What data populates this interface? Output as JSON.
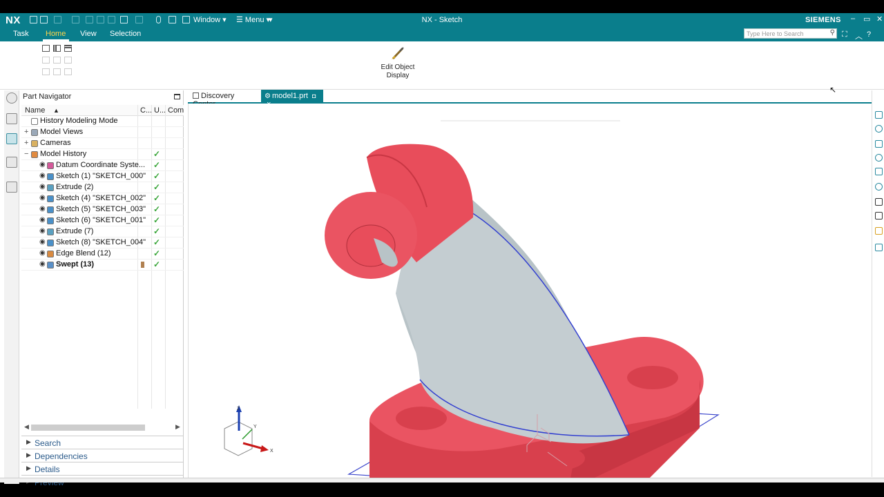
{
  "app": {
    "logo": "NX",
    "window_title": "NX - Sketch",
    "brand": "SIEMENS",
    "quick_access": {
      "window_label": "Window ▾",
      "menu_label": "☰ Menu ▾"
    }
  },
  "ribbon": {
    "tabs": [
      {
        "label": "Task",
        "active": false
      },
      {
        "label": "Home",
        "active": true
      },
      {
        "label": "View",
        "active": false
      },
      {
        "label": "Selection",
        "active": false
      }
    ],
    "search_placeholder": "Type Here to Search",
    "edit_object_display": {
      "line1": "Edit Object",
      "line2": "Display"
    }
  },
  "navigator": {
    "title": "Part Navigator",
    "columns": {
      "name": "Name",
      "c": "C...",
      "u": "U...",
      "com": "Com"
    },
    "rows": [
      {
        "label": "History Modeling Mode",
        "indent": 0,
        "expander": "",
        "eye": false,
        "icon": "history-icon",
        "icon_color": "#ffffff",
        "bold": false,
        "check": false
      },
      {
        "label": "Model Views",
        "indent": 0,
        "expander": "+",
        "eye": false,
        "icon": "views-icon",
        "icon_color": "#9aa8b8",
        "bold": false,
        "check": false
      },
      {
        "label": "Cameras",
        "indent": 0,
        "expander": "+",
        "eye": false,
        "icon": "camera-icon",
        "icon_color": "#d8b060",
        "bold": false,
        "check": false
      },
      {
        "label": "Model History",
        "indent": 0,
        "expander": "−",
        "eye": false,
        "icon": "history-folder-icon",
        "icon_color": "#e08a40",
        "bold": false,
        "check": true
      },
      {
        "label": "Datum Coordinate Syste...",
        "indent": 1,
        "expander": "",
        "eye": true,
        "icon": "datum-csys-icon",
        "icon_color": "#d45a9a",
        "bold": false,
        "check": true
      },
      {
        "label": "Sketch (1) \"SKETCH_000\"",
        "indent": 1,
        "expander": "",
        "eye": true,
        "icon": "sketch-icon",
        "icon_color": "#4a90c8",
        "bold": false,
        "check": true
      },
      {
        "label": "Extrude (2)",
        "indent": 1,
        "expander": "",
        "eye": true,
        "icon": "extrude-icon",
        "icon_color": "#5aa0c0",
        "bold": false,
        "check": true
      },
      {
        "label": "Sketch (4) \"SKETCH_002\"",
        "indent": 1,
        "expander": "",
        "eye": true,
        "icon": "sketch-icon",
        "icon_color": "#4a90c8",
        "bold": false,
        "check": true
      },
      {
        "label": "Sketch (5) \"SKETCH_003\"",
        "indent": 1,
        "expander": "",
        "eye": true,
        "icon": "sketch-icon",
        "icon_color": "#4a90c8",
        "bold": false,
        "check": true
      },
      {
        "label": "Sketch (6) \"SKETCH_001\"",
        "indent": 1,
        "expander": "",
        "eye": true,
        "icon": "sketch-icon",
        "icon_color": "#4a90c8",
        "bold": false,
        "check": true
      },
      {
        "label": "Extrude (7)",
        "indent": 1,
        "expander": "",
        "eye": true,
        "icon": "extrude-icon",
        "icon_color": "#5aa0c0",
        "bold": false,
        "check": true
      },
      {
        "label": "Sketch (8) \"SKETCH_004\"",
        "indent": 1,
        "expander": "",
        "eye": true,
        "icon": "sketch-icon",
        "icon_color": "#4a90c8",
        "bold": false,
        "check": true
      },
      {
        "label": "Edge Blend (12)",
        "indent": 1,
        "expander": "",
        "eye": true,
        "icon": "edge-blend-icon",
        "icon_color": "#d98a40",
        "bold": false,
        "check": true
      },
      {
        "label": "Swept (13)",
        "indent": 1,
        "expander": "",
        "eye": true,
        "icon": "swept-icon",
        "icon_color": "#5a90c8",
        "bold": true,
        "check": true,
        "flag": true
      }
    ],
    "panels": [
      "Search",
      "Dependencies",
      "Details",
      "Preview"
    ]
  },
  "doc_tabs": [
    {
      "label": "Discovery Center",
      "active": false
    },
    {
      "label": "model1.prt",
      "active": true,
      "modified_marker": "◘",
      "close": "×"
    }
  ],
  "triad": {
    "x": "X",
    "y": "Y",
    "z": "Z"
  },
  "colors": {
    "teal": "#0a7e8c",
    "part_red": "#e8505e",
    "swept_gray": "#b8c2c6",
    "edge_blue": "#3340d0",
    "check_green": "#3aa63a"
  }
}
